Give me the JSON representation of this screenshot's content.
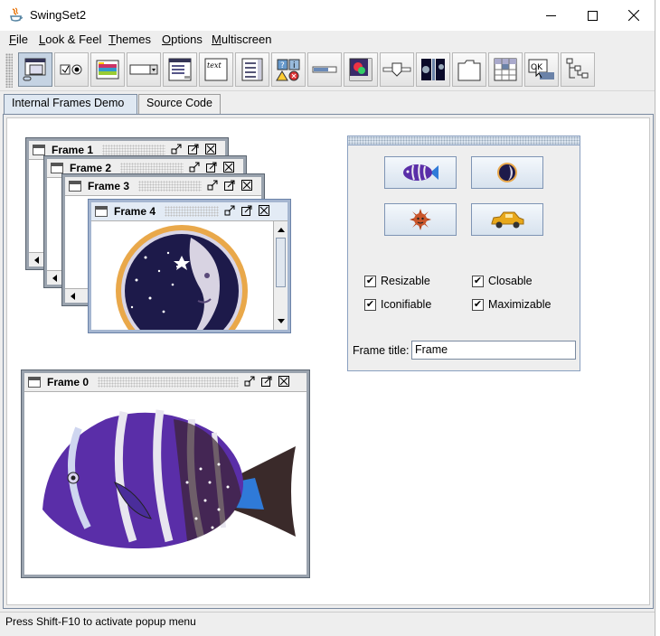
{
  "window": {
    "title": "SwingSet2"
  },
  "menu": [
    {
      "mn": "F",
      "rest": "ile"
    },
    {
      "mn": "L",
      "rest": "ook & Feel"
    },
    {
      "mn": "T",
      "rest": "hemes"
    },
    {
      "mn": "O",
      "rest": "ptions"
    },
    {
      "mn": "M",
      "rest": "ultiscreen"
    }
  ],
  "toolbar": {
    "icons": [
      "internal-frame-icon",
      "button-icon",
      "color-chooser-icon",
      "combobox-icon",
      "file-chooser-icon",
      "editor-pane-icon",
      "list-icon",
      "option-pane-icon",
      "progress-bar-icon",
      "scroll-pane-icon",
      "slider-icon",
      "split-pane-icon",
      "tabbed-pane-icon",
      "table-icon",
      "tooltip-icon",
      "tree-icon"
    ],
    "tooltip_icon_text": "OK",
    "text_icon_text": "text",
    "selected_index": 0
  },
  "tabs": [
    "Internal Frames Demo",
    "Source Code"
  ],
  "frames": {
    "f1": "Frame 1",
    "f2": "Frame 2",
    "f3": "Frame 3",
    "f4": "Frame 4",
    "f0": "Frame 0"
  },
  "controls": {
    "resizable": "Resizable",
    "closable": "Closable",
    "iconifiable": "Iconifiable",
    "maximizable": "Maximizable",
    "checked": "✔",
    "frame_title_label": "Frame title:",
    "frame_title_value": "Frame"
  },
  "status": "Press Shift-F10 to activate popup menu"
}
